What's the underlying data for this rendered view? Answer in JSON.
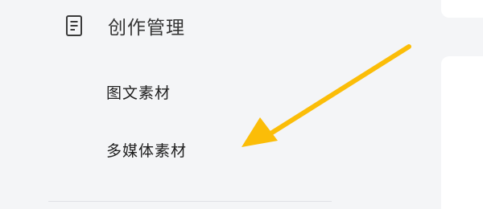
{
  "sidebar": {
    "section": {
      "icon": "document-icon",
      "title": "创作管理"
    },
    "items": [
      {
        "label": "图文素材"
      },
      {
        "label": "多媒体素材"
      }
    ]
  },
  "annotation": {
    "arrow_color": "#fbbd08"
  }
}
